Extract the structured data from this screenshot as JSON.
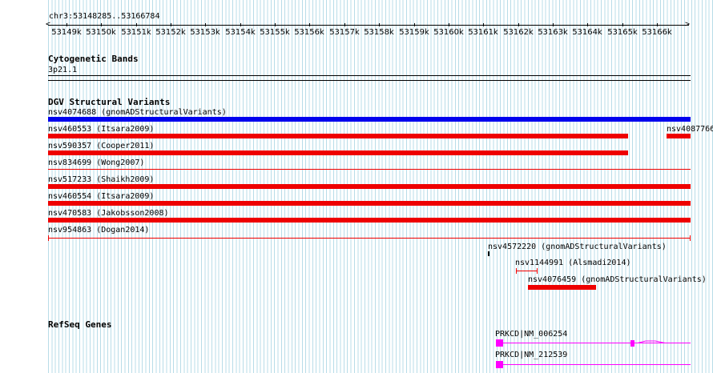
{
  "ruler": {
    "position": "chr3:53148285..53166784",
    "ticks": [
      "53149k",
      "53150k",
      "53151k",
      "53152k",
      "53153k",
      "53154k",
      "53155k",
      "53156k",
      "53157k",
      "53158k",
      "53159k",
      "53160k",
      "53161k",
      "53162k",
      "53163k",
      "53164k",
      "53165k",
      "53166k"
    ]
  },
  "cytoband": {
    "title": "Cytogenetic Bands",
    "band": "3p21.1"
  },
  "dgv": {
    "title": "DGV Structural Variants",
    "variants": [
      {
        "label": "nsv4074688 (gnomADStructuralVariants)",
        "color": "#0000ee"
      },
      {
        "label": "nsv460553 (Itsara2009)",
        "color": "#ee0000"
      },
      {
        "label": "nsv4087766",
        "color": "#ee0000"
      },
      {
        "label": "nsv590357 (Cooper2011)",
        "color": "#ee0000"
      },
      {
        "label": "nsv834699 (Wong2007)",
        "color": "#ee0000"
      },
      {
        "label": "nsv517233 (Shaikh2009)",
        "color": "#ee0000"
      },
      {
        "label": "nsv460554 (Itsara2009)",
        "color": "#ee0000"
      },
      {
        "label": "nsv470583 (Jakobsson2008)",
        "color": "#ee0000"
      },
      {
        "label": "nsv954863 (Dogan2014)",
        "color": "#ee0000"
      },
      {
        "label": "nsv4572220 (gnomADStructuralVariants)",
        "color": "#000000"
      },
      {
        "label": "nsv1144991 (Alsmadi2014)",
        "color": "#ee0000"
      },
      {
        "label": "nsv4076459 (gnomADStructuralVariants)",
        "color": "#ee0000"
      }
    ]
  },
  "refseq": {
    "title": "RefSeq Genes",
    "genes": [
      {
        "label": "PRKCD|NM_006254",
        "color": "#ff00ff"
      },
      {
        "label": "PRKCD|NM_212539",
        "color": "#ff00ff"
      }
    ]
  }
}
